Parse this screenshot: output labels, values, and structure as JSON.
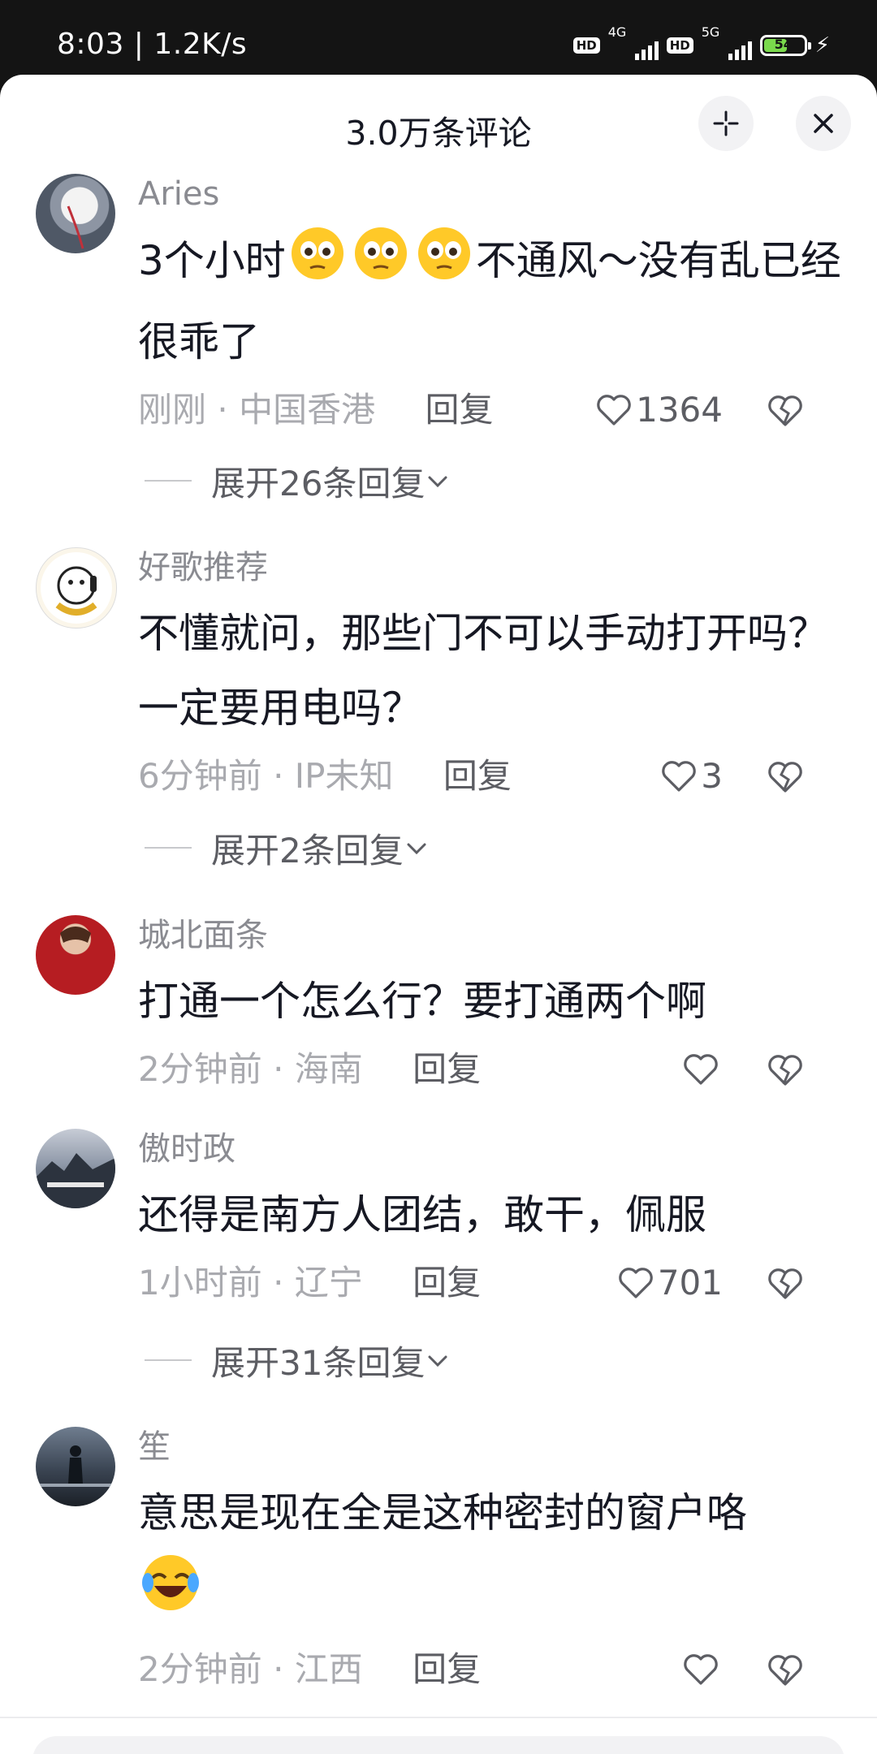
{
  "status_bar": {
    "time": "8:03 | 1.2K/s",
    "sim1_label": "HD",
    "sim1_network": "4G",
    "sim2_label": "HD",
    "sim2_network": "5G",
    "battery": "54"
  },
  "header": {
    "title": "3.0万条评论"
  },
  "comments": [
    {
      "user": "Aries",
      "text": "3个小时",
      "text_after_emoji": "不通风～没有乱已经很乖了",
      "emoji_count": 3,
      "time": "刚刚",
      "location": "中国香港",
      "reply": "回复",
      "likes": "1364",
      "expand": "展开26条回复"
    },
    {
      "user": "好歌推荐",
      "text": "不懂就问，那些门不可以手动打开吗？一定要用电吗？",
      "time": "6分钟前",
      "location": "IP未知",
      "reply": "回复",
      "likes": "3",
      "expand": "展开2条回复"
    },
    {
      "user": "城北面条",
      "text": "打通一个怎么行？要打通两个啊",
      "time": "2分钟前",
      "location": "海南",
      "reply": "回复",
      "likes": ""
    },
    {
      "user": "傲时政",
      "text": "还得是南方人团结，敢干，佩服",
      "time": "1小时前",
      "location": "辽宁",
      "reply": "回复",
      "likes": "701",
      "expand": "展开31条回复"
    },
    {
      "user": "笙",
      "text": "意思是现在全是这种密封的窗户咯",
      "time": "2分钟前",
      "location": "江西",
      "reply": "回复",
      "likes": ""
    }
  ],
  "meta_separator": " · ",
  "colors": {
    "accent_text": "#161823",
    "muted_text": "#a9aaaf",
    "battery": "#7ad94c"
  }
}
